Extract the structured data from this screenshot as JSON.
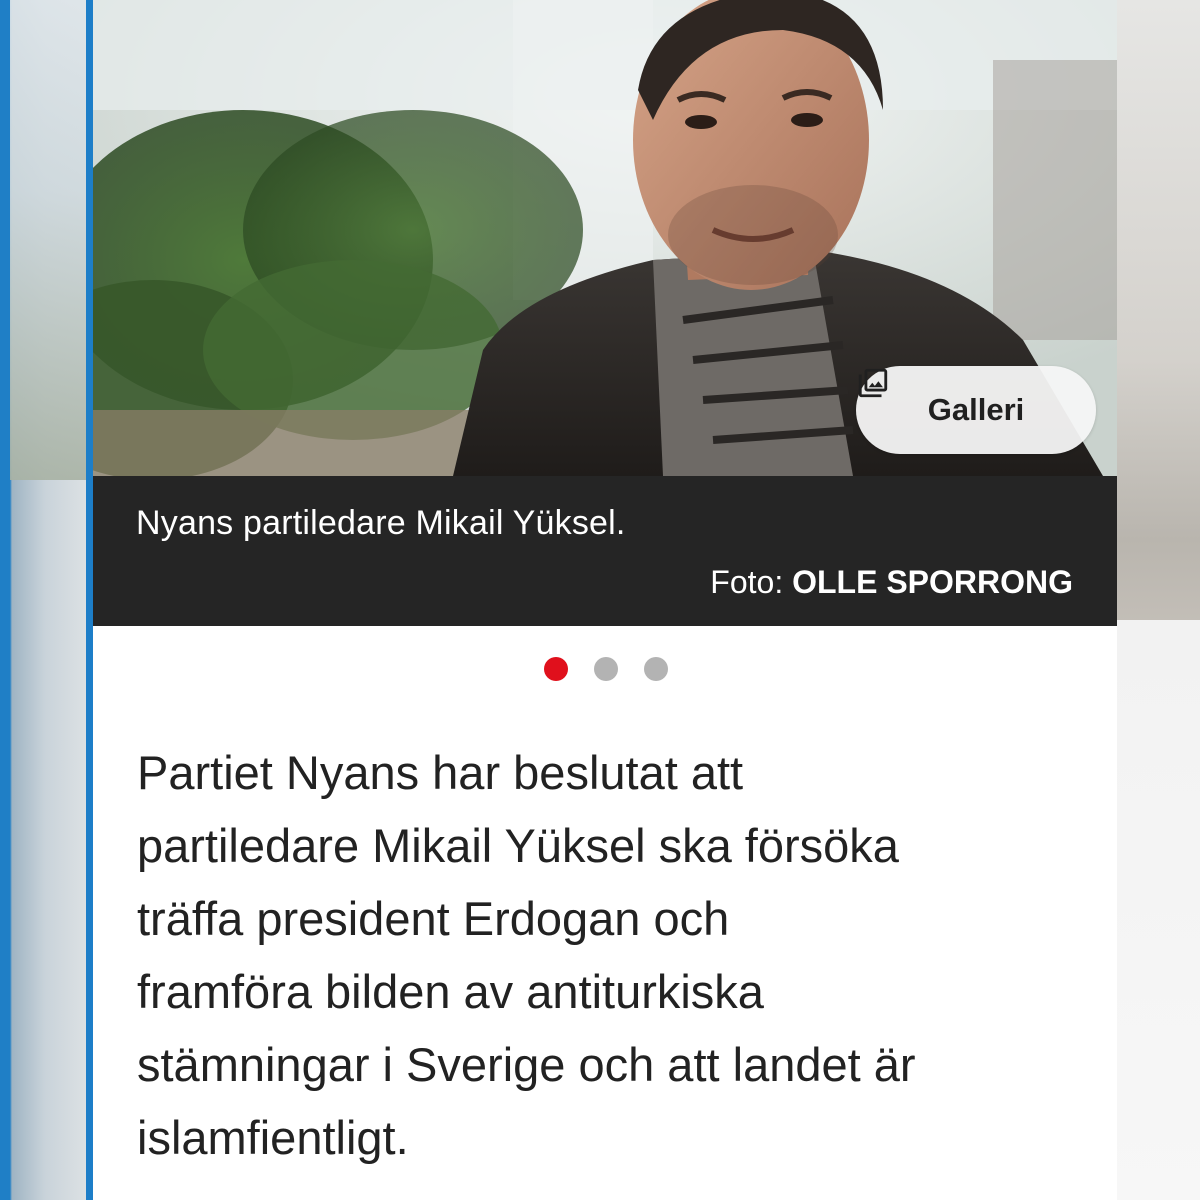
{
  "article": {
    "gallery_button_label": "Galleri",
    "caption": "Nyans partiledare Mikail Yüksel.",
    "credit_prefix": "Foto:",
    "credit_name": "OLLE SPORRONG",
    "carousel": {
      "count": 3,
      "active_index": 0
    },
    "lead_lines": [
      "Partiet Nyans har beslutat att",
      "partiledare Mikail Yüksel ska försöka",
      "träffa president Erdogan och",
      "framföra bilden av antiturkiska",
      "stämningar i Sverige och att landet är",
      "islamfientligt."
    ]
  },
  "colors": {
    "accent_rule": "#1d7ec8",
    "active_dot": "#e0101c",
    "inactive_dot": "#b3b3b3",
    "caption_bg": "#252525"
  },
  "icons": {
    "gallery": "photo-library-icon"
  }
}
